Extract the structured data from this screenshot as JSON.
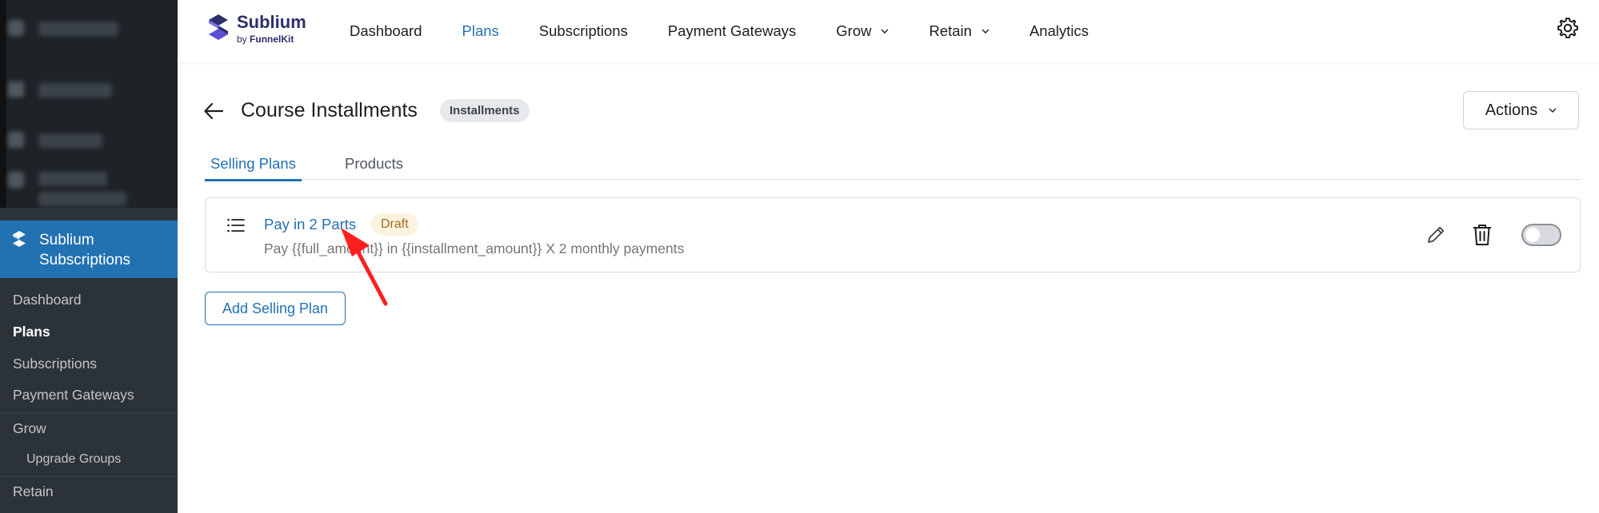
{
  "sidebar": {
    "active_menu": "Sublium Subscriptions",
    "items": [
      {
        "label": "Dashboard",
        "current": false
      },
      {
        "label": "Plans",
        "current": true
      },
      {
        "label": "Subscriptions",
        "current": false
      },
      {
        "label": "Payment Gateways",
        "current": false
      },
      {
        "label": "Grow",
        "current": false
      },
      {
        "label": "Upgrade Groups",
        "current": false
      },
      {
        "label": "Retain",
        "current": false
      }
    ]
  },
  "brand": {
    "name": "Sublium",
    "by_prefix": "by",
    "by_company": "FunnelKit"
  },
  "topnav": {
    "items": [
      {
        "label": "Dashboard",
        "active": false,
        "dropdown": false
      },
      {
        "label": "Plans",
        "active": true,
        "dropdown": false
      },
      {
        "label": "Subscriptions",
        "active": false,
        "dropdown": false
      },
      {
        "label": "Payment Gateways",
        "active": false,
        "dropdown": false
      },
      {
        "label": "Grow",
        "active": false,
        "dropdown": true
      },
      {
        "label": "Retain",
        "active": false,
        "dropdown": true
      },
      {
        "label": "Analytics",
        "active": false,
        "dropdown": false
      }
    ],
    "settings_icon": "gear-icon"
  },
  "page": {
    "title": "Course Installments",
    "type_badge": "Installments",
    "actions_label": "Actions"
  },
  "tabs": [
    {
      "label": "Selling Plans",
      "active": true
    },
    {
      "label": "Products",
      "active": false
    }
  ],
  "plans": [
    {
      "name": "Pay in 2 Parts",
      "status": "Draft",
      "description": "Pay {{full_amount}} in {{installment_amount}} X 2 monthly payments",
      "enabled": false
    }
  ],
  "add_plan_label": "Add Selling Plan",
  "colors": {
    "accent": "#2271b1",
    "sidebar_bg": "#2c3338",
    "draft_badge_bg": "#fcf3e0",
    "draft_badge_text": "#a36d1a",
    "annotation_arrow": "#ff1f1f"
  }
}
